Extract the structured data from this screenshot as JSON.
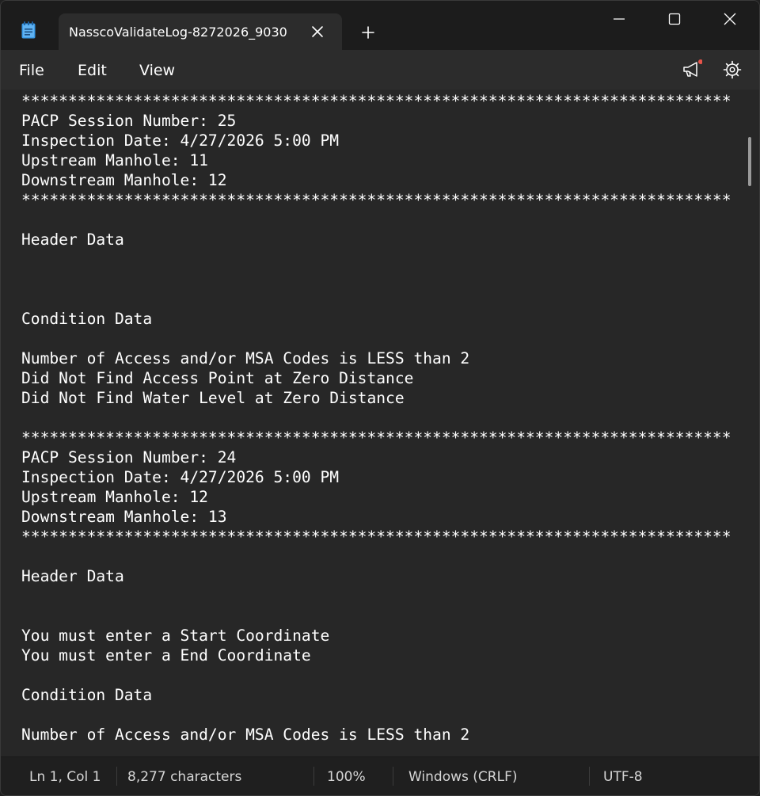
{
  "window": {
    "tab_title": "NasscoValidateLog-8272026_9030"
  },
  "menu": {
    "file": "File",
    "edit": "Edit",
    "view": "View"
  },
  "icons": {
    "app": "notepad-icon",
    "close_tab": "close-icon",
    "new_tab": "plus-icon",
    "minimize": "minimize-icon",
    "maximize": "maximize-icon",
    "close_window": "close-icon",
    "whats_new": "megaphone-icon",
    "settings": "gear-icon"
  },
  "colors": {
    "notification_dot": "#e8544a"
  },
  "document": {
    "text": "****************************************************************************\nPACP Session Number: 25\nInspection Date: 4/27/2026 5:00 PM\nUpstream Manhole: 11\nDownstream Manhole: 12\n****************************************************************************\n\nHeader Data\n\n\n\nCondition Data\n\nNumber of Access and/or MSA Codes is LESS than 2\nDid Not Find Access Point at Zero Distance\nDid Not Find Water Level at Zero Distance\n\n****************************************************************************\nPACP Session Number: 24\nInspection Date: 4/27/2026 5:00 PM\nUpstream Manhole: 12\nDownstream Manhole: 13\n****************************************************************************\n\nHeader Data\n\n\nYou must enter a Start Coordinate\nYou must enter a End Coordinate\n\nCondition Data\n\nNumber of Access and/or MSA Codes is LESS than 2"
  },
  "status": {
    "position": "Ln 1, Col 1",
    "characters": "8,277 characters",
    "zoom": "100%",
    "line_ending": "Windows (CRLF)",
    "encoding": "UTF-8"
  }
}
